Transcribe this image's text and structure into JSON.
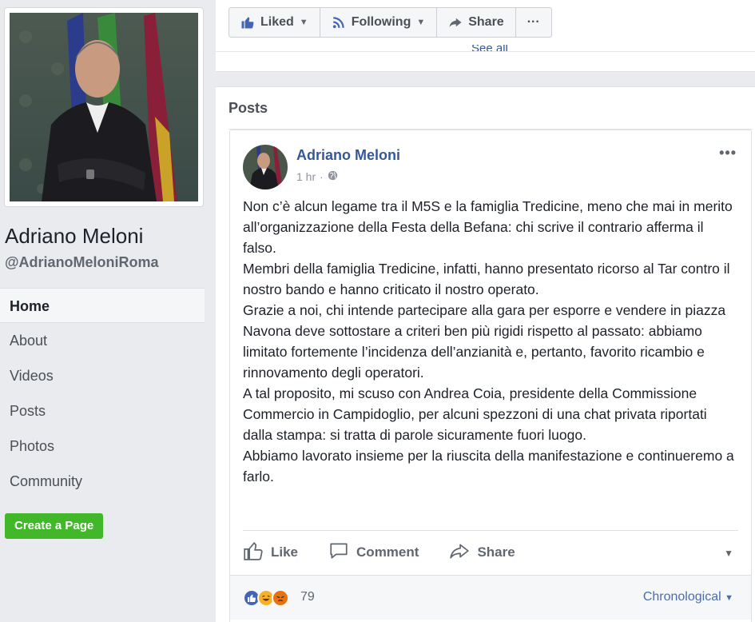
{
  "sidebar": {
    "page_name": "Adriano Meloni",
    "handle": "@AdrianoMeloniRoma",
    "nav": [
      {
        "label": "Home"
      },
      {
        "label": "About"
      },
      {
        "label": "Videos"
      },
      {
        "label": "Posts"
      },
      {
        "label": "Photos"
      },
      {
        "label": "Community"
      }
    ],
    "create_page_label": "Create a Page"
  },
  "header": {
    "liked_label": "Liked",
    "following_label": "Following",
    "share_label": "Share",
    "more_label": "···",
    "see_all_label": "See all"
  },
  "posts": {
    "title": "Posts",
    "post": {
      "author": "Adriano Meloni",
      "time": "1 hr",
      "separator": "·",
      "body": [
        "Non c’è alcun legame tra il M5S e la famiglia Tredicine, meno che mai in merito all’organizzazione della Festa della Befana: chi scrive il contrario afferma il falso.",
        "Membri della famiglia Tredicine, infatti, hanno presentato ricorso al Tar contro il nostro bando e hanno criticato il nostro operato.",
        "Grazie a noi, chi intende partecipare alla gara per esporre e vendere in piazza Navona deve sottostare a criteri ben più rigidi rispetto al passato: abbiamo limitato fortemente l’incidenza dell’anzianità e, pertanto, favorito ricambio e rinnovamento degli operatori.",
        "A tal proposito, mi scuso con Andrea Coia, presidente della Commissione Commercio in Campidoglio, per alcuni spezzoni di una chat privata riportati dalla stampa: si tratta di parole sicuramente fuori luogo.",
        "Abbiamo lavorato insieme per la riuscita della manifestazione e continueremo a farlo."
      ],
      "like_label": "Like",
      "comment_label": "Comment",
      "share_label": "Share",
      "reaction_count": "79",
      "sort_label": "Chronological"
    }
  },
  "colors": {
    "link_blue": "#365899",
    "create_green": "#42b72a",
    "like_blue": "#4267b2",
    "haha_yellow": "#f7b125",
    "angry_red": "#e9710f"
  }
}
